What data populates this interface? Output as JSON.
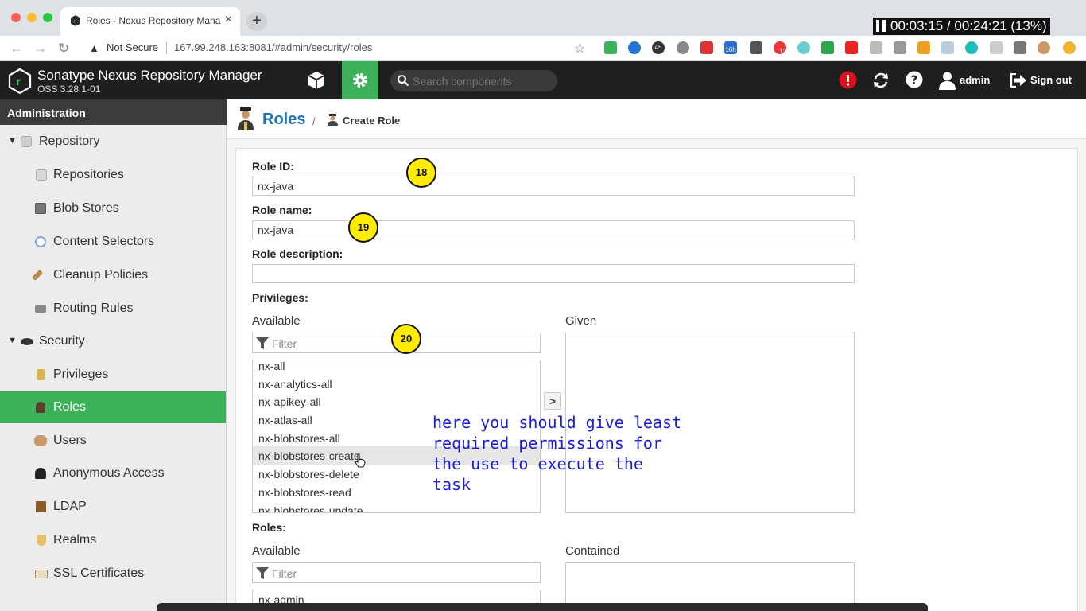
{
  "browser": {
    "tab_title": "Roles - Nexus Repository Mana",
    "tab_close": "×",
    "new_tab": "+",
    "not_secure": "Not Secure",
    "url": "167.99.248.163:8081/#admin/security/roles"
  },
  "recorder": {
    "elapsed": "00:03:15",
    "sep": "/",
    "total": "00:24:21",
    "percent": "(13%)"
  },
  "extensions": {
    "badge_45": "45",
    "badge_16h": "16h",
    "badge_12": "12"
  },
  "header": {
    "title": "Sonatype Nexus Repository Manager",
    "version": "OSS 3.28.1-01",
    "search_placeholder": "Search components",
    "user": "admin",
    "signout": "Sign out"
  },
  "sidebar": {
    "heading": "Administration",
    "items": [
      {
        "label": "Repository",
        "group": true
      },
      {
        "label": "Repositories"
      },
      {
        "label": "Blob Stores"
      },
      {
        "label": "Content Selectors"
      },
      {
        "label": "Cleanup Policies"
      },
      {
        "label": "Routing Rules"
      },
      {
        "label": "Security",
        "group": true
      },
      {
        "label": "Privileges"
      },
      {
        "label": "Roles",
        "active": true
      },
      {
        "label": "Users"
      },
      {
        "label": "Anonymous Access"
      },
      {
        "label": "LDAP"
      },
      {
        "label": "Realms"
      },
      {
        "label": "SSL Certificates"
      }
    ]
  },
  "breadcrumb": {
    "root": "Roles",
    "sep": "/",
    "current": "Create Role"
  },
  "form": {
    "role_id_label": "Role ID:",
    "role_id_value": "nx-java",
    "role_name_label": "Role name:",
    "role_name_value": "nx-java",
    "role_desc_label": "Role description:",
    "role_desc_value": "",
    "privileges_label": "Privileges:",
    "available_label": "Available",
    "given_label": "Given",
    "filter_placeholder": "Filter",
    "move_right": ">",
    "privileges_available": [
      "nx-all",
      "nx-analytics-all",
      "nx-apikey-all",
      "nx-atlas-all",
      "nx-blobstores-all",
      "nx-blobstores-create",
      "nx-blobstores-delete",
      "nx-blobstores-read",
      "nx-blobstores-update"
    ],
    "roles_label": "Roles:",
    "roles_available_label": "Available",
    "contained_label": "Contained",
    "roles_available": [
      "nx-admin"
    ]
  },
  "annotations": {
    "step_18": "18",
    "step_19": "19",
    "step_20": "20",
    "note": "here you should give least\nrequired permissions for\nthe use to execute the\ntask"
  },
  "colors": {
    "brand_green": "#3db15a",
    "header_dark": "#1f1f1f",
    "link_blue": "#1a73b8",
    "step_yellow": "#ffec00",
    "note_blue": "#1a1adb"
  }
}
